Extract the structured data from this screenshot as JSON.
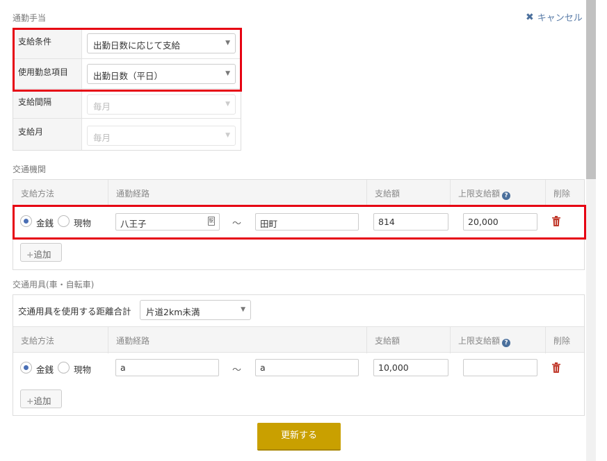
{
  "section_titles": {
    "commute_allowance": "通勤手当",
    "transport": "交通機関",
    "vehicle": "交通用具(車・自転車)"
  },
  "cancel_label": "キャンセル",
  "conditions": [
    {
      "label": "支給条件",
      "value": "出勤日数に応じて支給",
      "enabled": true
    },
    {
      "label": "使用勤怠項目",
      "value": "出勤日数（平日）",
      "enabled": true
    },
    {
      "label": "支給間隔",
      "value": "毎月",
      "enabled": false
    },
    {
      "label": "支給月",
      "value": "毎月",
      "enabled": false
    }
  ],
  "columns": {
    "method": "支給方法",
    "route": "通勤経路",
    "amount": "支給額",
    "limit": "上限支給額",
    "delete": "削除"
  },
  "payment_options": {
    "cash": "金銭",
    "goods": "現物"
  },
  "transport_row": {
    "method_selected": "cash",
    "from": "八王子",
    "to": "田町",
    "tilde": "～",
    "amount": "814",
    "limit": "20,000"
  },
  "station_icon_glyph": "駅",
  "add_label": "追加",
  "distance_label": "交通用具を使用する距離合計",
  "distance_value": "片道2km未満",
  "vehicle_row": {
    "method_selected": "cash",
    "from": "a",
    "to": "a",
    "tilde": "～",
    "amount": "10,000",
    "limit": ""
  },
  "update_label": "更新する",
  "colors": {
    "highlight": "#e60012",
    "primary": "#c9a000",
    "link": "#4a6f9c",
    "trash": "#c0392b"
  }
}
